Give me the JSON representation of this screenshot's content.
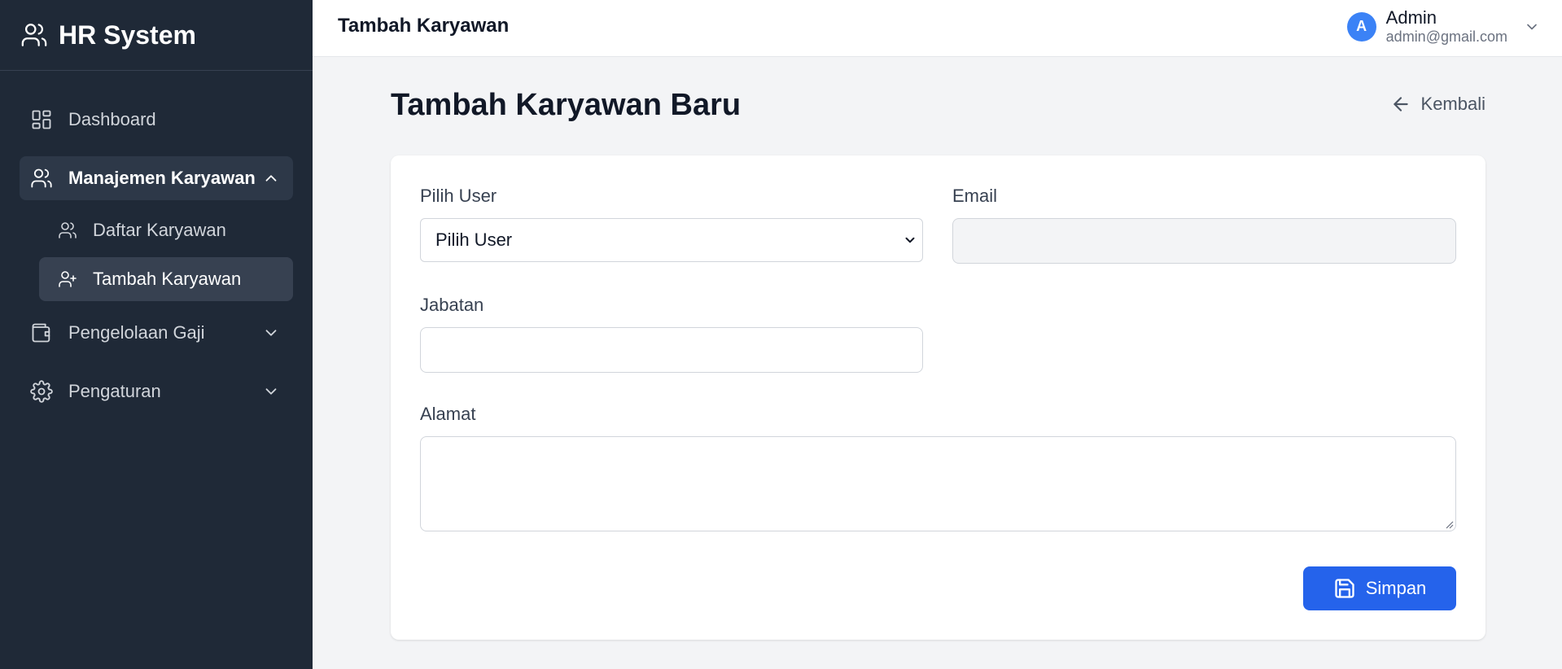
{
  "sidebar": {
    "brand": "HR System",
    "items": [
      {
        "label": "Dashboard",
        "icon": "dashboard-icon"
      },
      {
        "label": "Manajemen Karyawan",
        "icon": "users-icon",
        "expanded": true,
        "children": [
          {
            "label": "Daftar Karyawan",
            "icon": "users-icon"
          },
          {
            "label": "Tambah Karyawan",
            "icon": "user-plus-icon",
            "active": true
          }
        ]
      },
      {
        "label": "Pengelolaan Gaji",
        "icon": "wallet-icon"
      },
      {
        "label": "Pengaturan",
        "icon": "gear-icon"
      }
    ]
  },
  "header": {
    "title": "Tambah Karyawan",
    "user": {
      "initial": "A",
      "name": "Admin",
      "email": "admin@gmail.com"
    }
  },
  "main": {
    "title": "Tambah Karyawan Baru",
    "back_label": "Kembali",
    "form": {
      "user_label": "Pilih User",
      "user_selected": "Pilih User",
      "email_label": "Email",
      "email_value": "",
      "position_label": "Jabatan",
      "position_value": "",
      "address_label": "Alamat",
      "address_value": "",
      "save_label": "Simpan"
    }
  },
  "colors": {
    "sidebar_bg": "#1f2937",
    "accent": "#2563eb",
    "avatar": "#3b82f6",
    "page_bg": "#f3f4f6"
  }
}
